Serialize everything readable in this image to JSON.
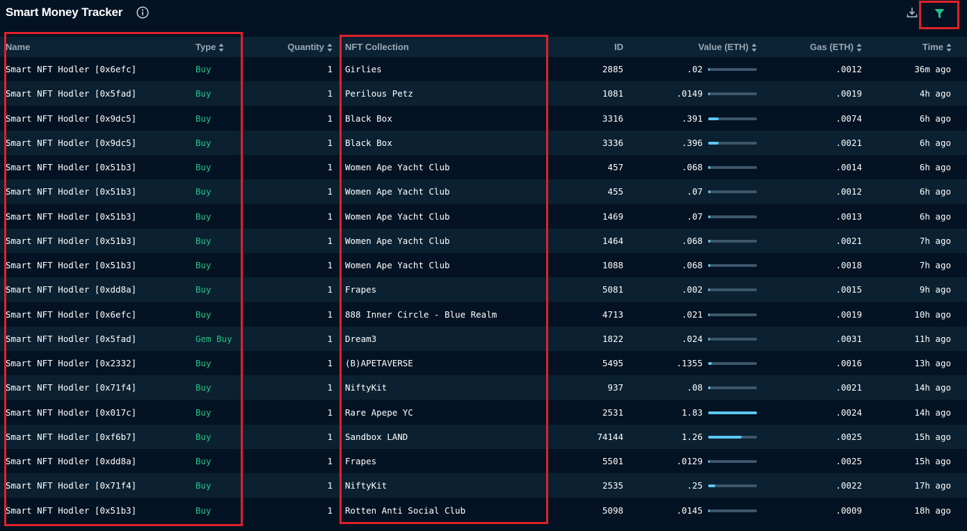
{
  "header": {
    "title": "Smart Money Tracker"
  },
  "icons": {
    "info": "info-icon",
    "download": "download-icon",
    "filter": "filter-icon"
  },
  "colors": {
    "background": "#041323",
    "buy": "#27c184",
    "bar_fill": "#5cc8f5",
    "highlight": "#e0222a",
    "filter": "#27c184"
  },
  "table": {
    "columns": {
      "name": "Name",
      "type": "Type",
      "quantity": "Quantity",
      "collection": "NFT Collection",
      "id": "ID",
      "value": "Value (ETH)",
      "gas": "Gas (ETH)",
      "time": "Time"
    },
    "rows": [
      {
        "name": "Smart NFT Hodler [0x6efc]",
        "type": "Buy",
        "quantity": "1",
        "collection": "Girlies",
        "id": "2885",
        "value": ".02",
        "value_fraction": 0.011,
        "gas": ".0012",
        "time": "36m ago"
      },
      {
        "name": "Smart NFT Hodler [0x5fad]",
        "type": "Buy",
        "quantity": "1",
        "collection": "Perilous Petz",
        "id": "1081",
        "value": ".0149",
        "value_fraction": 0.008,
        "gas": ".0019",
        "time": "4h ago"
      },
      {
        "name": "Smart NFT Hodler [0x9dc5]",
        "type": "Buy",
        "quantity": "1",
        "collection": "Black Box",
        "id": "3316",
        "value": ".391",
        "value_fraction": 0.214,
        "gas": ".0074",
        "time": "6h ago"
      },
      {
        "name": "Smart NFT Hodler [0x9dc5]",
        "type": "Buy",
        "quantity": "1",
        "collection": "Black Box",
        "id": "3336",
        "value": ".396",
        "value_fraction": 0.216,
        "gas": ".0021",
        "time": "6h ago"
      },
      {
        "name": "Smart NFT Hodler [0x51b3]",
        "type": "Buy",
        "quantity": "1",
        "collection": "Women Ape Yacht Club",
        "id": "457",
        "value": ".068",
        "value_fraction": 0.037,
        "gas": ".0014",
        "time": "6h ago"
      },
      {
        "name": "Smart NFT Hodler [0x51b3]",
        "type": "Buy",
        "quantity": "1",
        "collection": "Women Ape Yacht Club",
        "id": "455",
        "value": ".07",
        "value_fraction": 0.038,
        "gas": ".0012",
        "time": "6h ago"
      },
      {
        "name": "Smart NFT Hodler [0x51b3]",
        "type": "Buy",
        "quantity": "1",
        "collection": "Women Ape Yacht Club",
        "id": "1469",
        "value": ".07",
        "value_fraction": 0.038,
        "gas": ".0013",
        "time": "6h ago"
      },
      {
        "name": "Smart NFT Hodler [0x51b3]",
        "type": "Buy",
        "quantity": "1",
        "collection": "Women Ape Yacht Club",
        "id": "1464",
        "value": ".068",
        "value_fraction": 0.037,
        "gas": ".0021",
        "time": "7h ago"
      },
      {
        "name": "Smart NFT Hodler [0x51b3]",
        "type": "Buy",
        "quantity": "1",
        "collection": "Women Ape Yacht Club",
        "id": "1088",
        "value": ".068",
        "value_fraction": 0.037,
        "gas": ".0018",
        "time": "7h ago"
      },
      {
        "name": "Smart NFT Hodler [0xdd8a]",
        "type": "Buy",
        "quantity": "1",
        "collection": "Frapes",
        "id": "5081",
        "value": ".002",
        "value_fraction": 0.001,
        "gas": ".0015",
        "time": "9h ago"
      },
      {
        "name": "Smart NFT Hodler [0x6efc]",
        "type": "Buy",
        "quantity": "1",
        "collection": "888 Inner Circle - Blue Realm",
        "id": "4713",
        "value": ".021",
        "value_fraction": 0.011,
        "gas": ".0019",
        "time": "10h ago"
      },
      {
        "name": "Smart NFT Hodler [0x5fad]",
        "type": "Gem Buy",
        "quantity": "1",
        "collection": "Dream3",
        "id": "1822",
        "value": ".024",
        "value_fraction": 0.013,
        "gas": ".0031",
        "time": "11h ago"
      },
      {
        "name": "Smart NFT Hodler [0x2332]",
        "type": "Buy",
        "quantity": "1",
        "collection": "(B)APETAVERSE",
        "id": "5495",
        "value": ".1355",
        "value_fraction": 0.074,
        "gas": ".0016",
        "time": "13h ago"
      },
      {
        "name": "Smart NFT Hodler [0x71f4]",
        "type": "Buy",
        "quantity": "1",
        "collection": "NiftyKit",
        "id": "937",
        "value": ".08",
        "value_fraction": 0.044,
        "gas": ".0021",
        "time": "14h ago"
      },
      {
        "name": "Smart NFT Hodler [0x017c]",
        "type": "Buy",
        "quantity": "1",
        "collection": "Rare Apepe YC",
        "id": "2531",
        "value": "1.83",
        "value_fraction": 1.0,
        "gas": ".0024",
        "time": "14h ago"
      },
      {
        "name": "Smart NFT Hodler [0xf6b7]",
        "type": "Buy",
        "quantity": "1",
        "collection": "Sandbox LAND",
        "id": "74144",
        "value": "1.26",
        "value_fraction": 0.689,
        "gas": ".0025",
        "time": "15h ago"
      },
      {
        "name": "Smart NFT Hodler [0xdd8a]",
        "type": "Buy",
        "quantity": "1",
        "collection": "Frapes",
        "id": "5501",
        "value": ".0129",
        "value_fraction": 0.007,
        "gas": ".0025",
        "time": "15h ago"
      },
      {
        "name": "Smart NFT Hodler [0x71f4]",
        "type": "Buy",
        "quantity": "1",
        "collection": "NiftyKit",
        "id": "2535",
        "value": ".25",
        "value_fraction": 0.137,
        "gas": ".0022",
        "time": "17h ago"
      },
      {
        "name": "Smart NFT Hodler [0x51b3]",
        "type": "Buy",
        "quantity": "1",
        "collection": "Rotten Anti Social Club",
        "id": "5098",
        "value": ".0145",
        "value_fraction": 0.008,
        "gas": ".0009",
        "time": "18h ago"
      }
    ]
  }
}
